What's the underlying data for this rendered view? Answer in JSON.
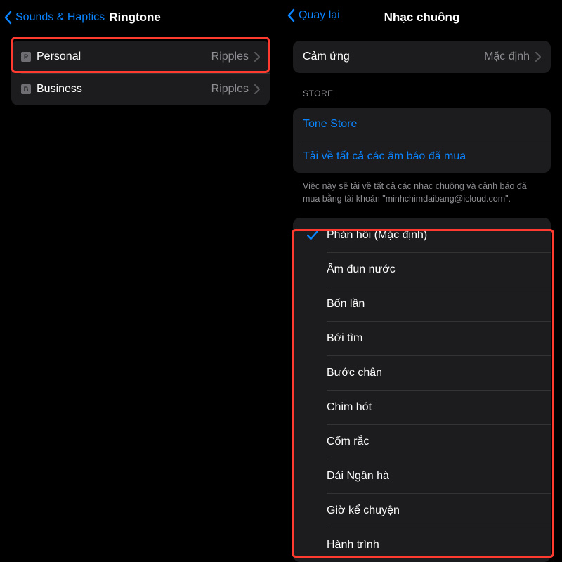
{
  "left": {
    "back_label": "Sounds & Haptics",
    "title": "Ringtone",
    "sims": [
      {
        "badge": "P",
        "name": "Personal",
        "value": "Ripples"
      },
      {
        "badge": "B",
        "name": "Business",
        "value": "Ripples"
      }
    ]
  },
  "right": {
    "back_label": "Quay lại",
    "title": "Nhạc chuông",
    "haptic": {
      "label": "Cảm ứng",
      "value": "Mặc định"
    },
    "store_header": "STORE",
    "tone_store": "Tone Store",
    "download_all": "Tải về tất cả các âm báo đã mua",
    "download_footer": "Việc này sẽ tải về tất cả các nhạc chuông và cảnh báo đã mua bằng tài khoản \"minhchimdaibang@icloud.com\".",
    "ringtones": [
      {
        "name": "Phản hồi (Mặc định)",
        "selected": true
      },
      {
        "name": "Ấm đun nước",
        "selected": false
      },
      {
        "name": "Bốn lần",
        "selected": false
      },
      {
        "name": "Bới tìm",
        "selected": false
      },
      {
        "name": "Bước chân",
        "selected": false
      },
      {
        "name": "Chim hót",
        "selected": false
      },
      {
        "name": "Cốm rắc",
        "selected": false
      },
      {
        "name": "Dải Ngân hà",
        "selected": false
      },
      {
        "name": "Giờ kể chuyện",
        "selected": false
      },
      {
        "name": "Hành trình",
        "selected": false
      }
    ]
  }
}
